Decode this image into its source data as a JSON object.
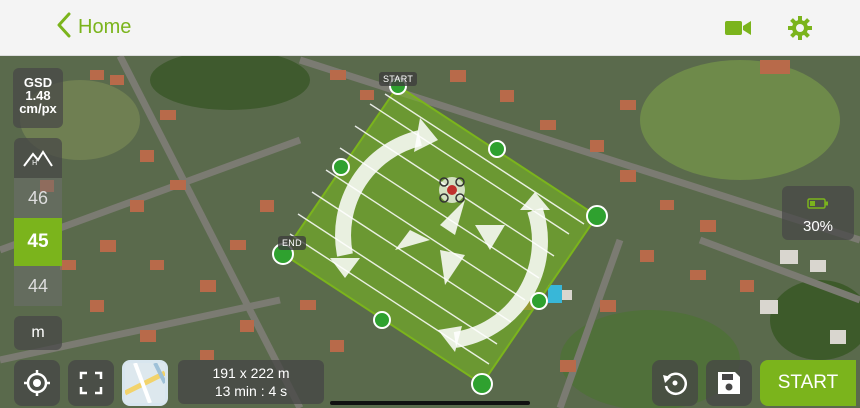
{
  "header": {
    "back_label": "Home"
  },
  "icons": {
    "back": "chevron-left-icon",
    "camera": "video-camera-icon",
    "settings": "gear-icon",
    "altitude": "mountain-altitude-icon",
    "locate": "crosshair-location-icon",
    "fullscreen": "fullscreen-icon",
    "map_type": "map-layer-icon",
    "rotate": "rotate-icon",
    "save": "save-icon",
    "battery": "battery-icon"
  },
  "gsd": {
    "label": "GSD",
    "value": "1.48",
    "unit": "cm/px"
  },
  "altitude": {
    "above": "46",
    "selected": "45",
    "below": "44",
    "unit": "m"
  },
  "battery": {
    "percent": "30%"
  },
  "mission": {
    "start_tag": "START",
    "end_tag": "END",
    "area": "191 x 222 m",
    "duration": "13 min : 4 s"
  },
  "actions": {
    "start_label": "START"
  },
  "colors": {
    "accent": "#7bb41c",
    "panel": "#464646"
  }
}
